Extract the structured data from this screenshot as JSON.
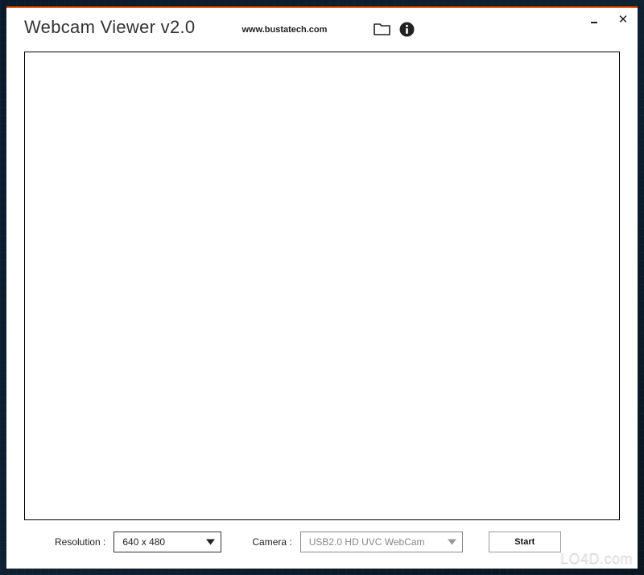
{
  "header": {
    "title": "Webcam Viewer v2.0",
    "url": "www.bustatech.com"
  },
  "icons": {
    "folder": "folder-icon",
    "info": "info-icon"
  },
  "toolbar": {
    "resolution_label": "Resolution :",
    "resolution_value": "640 x 480",
    "camera_label": "Camera :",
    "camera_value": "USB2.0 HD UVC WebCam",
    "start_label": "Start"
  },
  "watermark": "LO4D.com"
}
